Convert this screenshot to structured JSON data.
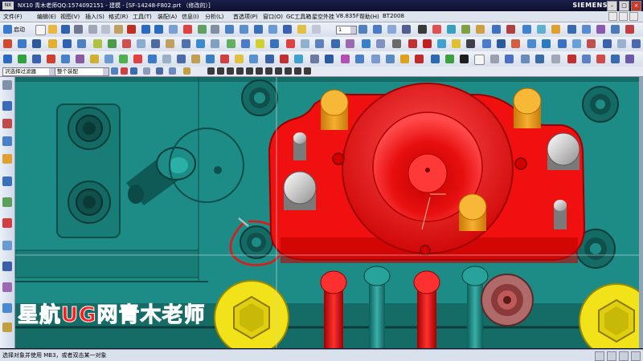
{
  "window": {
    "title": "NX10 青木老师QQ:1574092151 - 建模 - [SF-14248-F802.prt （修改的）]",
    "brand": "SIEMENS",
    "logo_text": "NX"
  },
  "menu": [
    "文件(F)",
    "编辑(E)",
    "视图(V)",
    "插入(S)",
    "格式(R)",
    "工具(T)",
    "装配(A)",
    "信息(I)",
    "分析(L)",
    "首选项(P)",
    "窗口(O)",
    "GC工具箱",
    "星空外挂",
    "V8.835F",
    "帮助(H)",
    "BT2008"
  ],
  "toolbar": {
    "start_label": "启动",
    "layer_value": "1"
  },
  "filter": {
    "selection_filter": "沢选择过滤器",
    "assembly_scope": "整个装配"
  },
  "status": {
    "message": "选择对象并使用 MB3，或者双击某一对象"
  },
  "watermark": "星航UG网青木老师",
  "colors": {
    "model_teal": "#1e8c86",
    "model_red": "#f01010",
    "pin_orange": "#f0a020",
    "screw_yellow": "#f2e21a",
    "annotation_red": "#e01818"
  }
}
